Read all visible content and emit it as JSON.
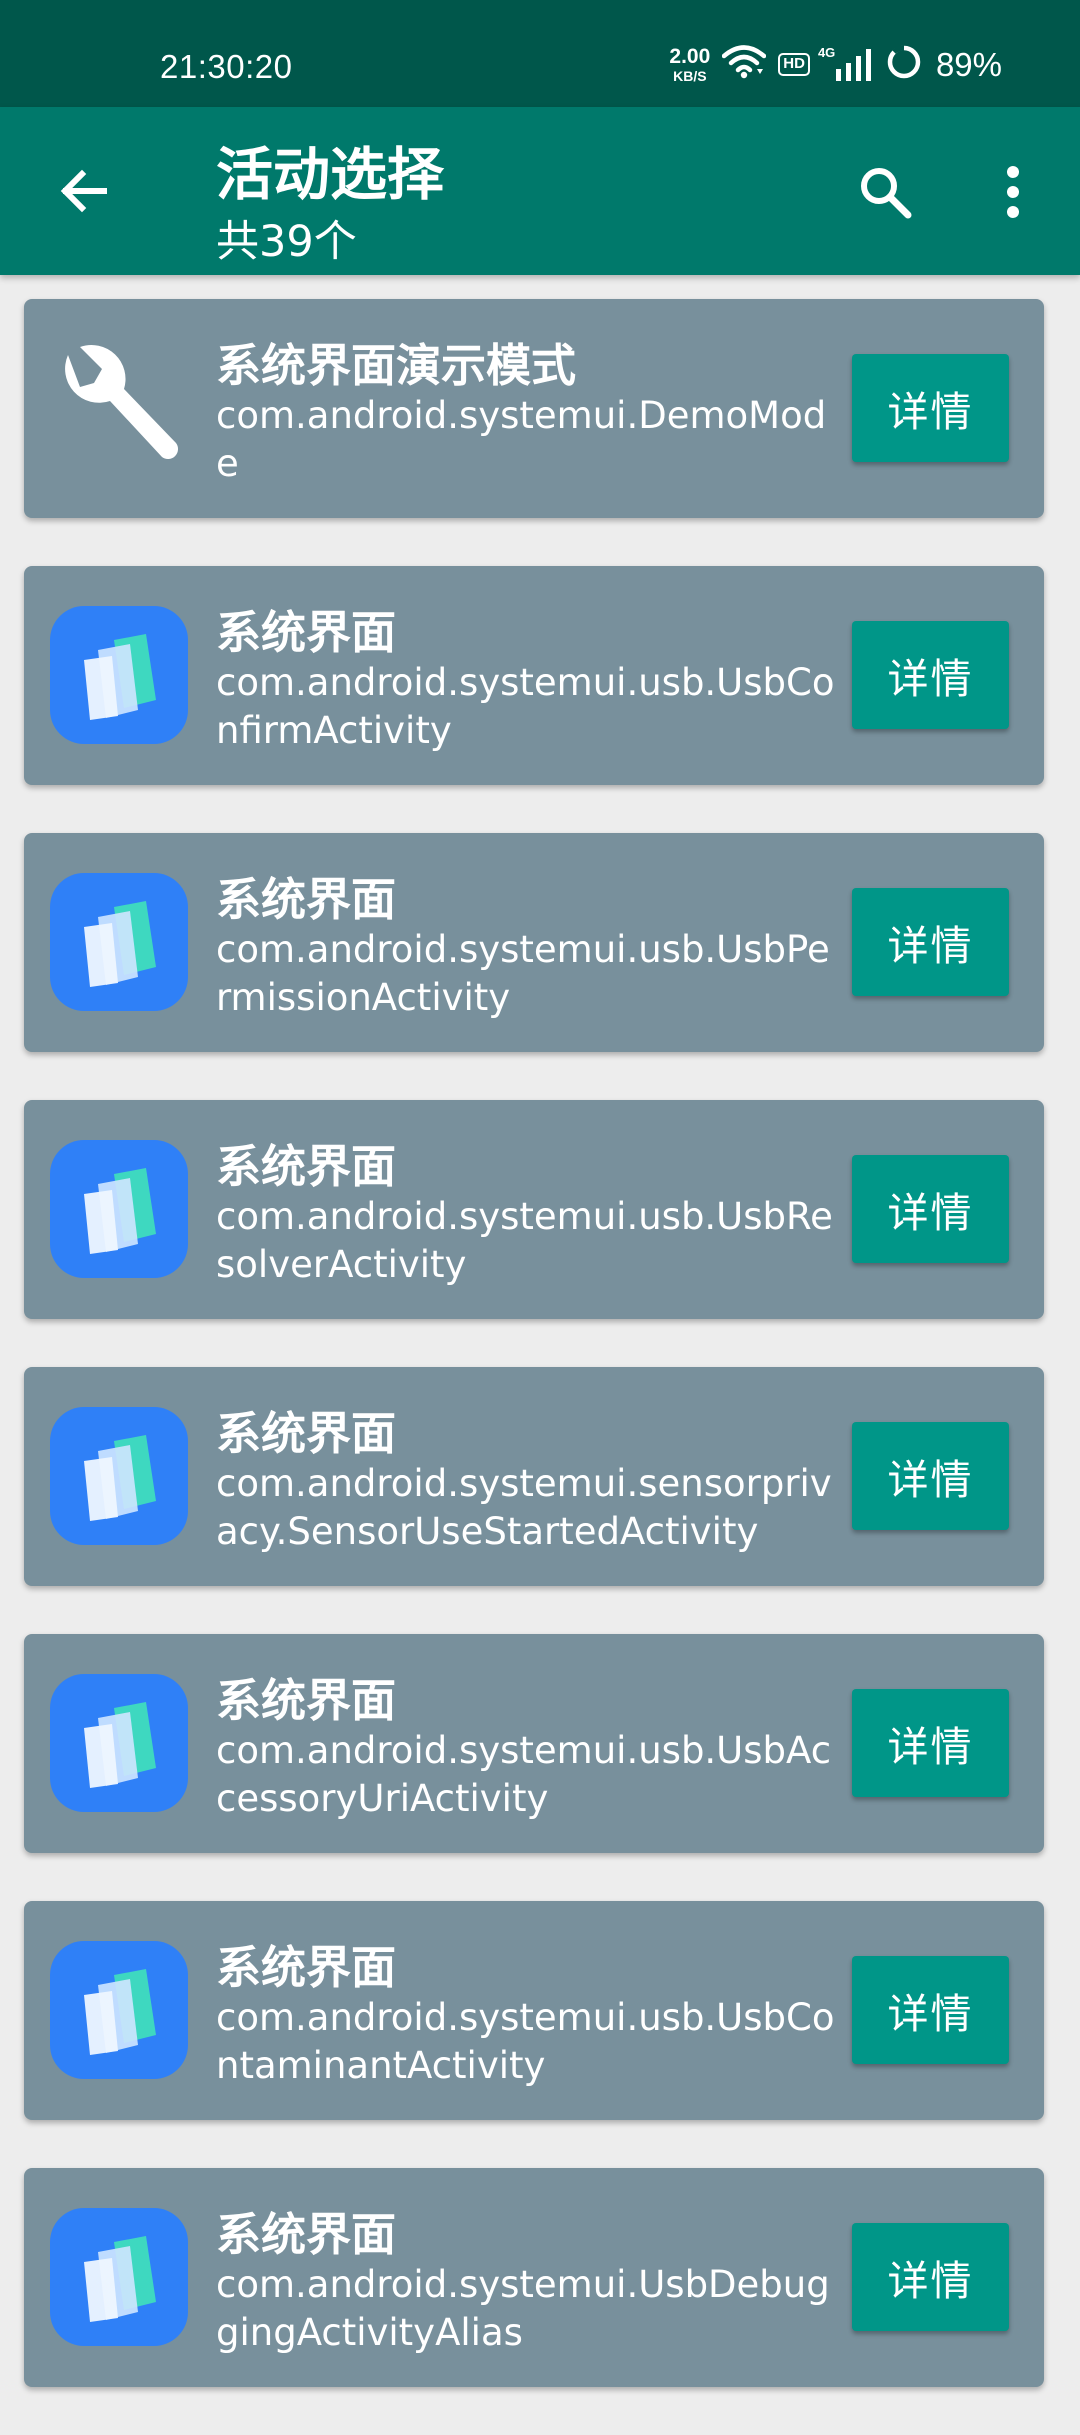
{
  "status_bar": {
    "time": "21:30:20",
    "net_speed_value": "2.00",
    "net_speed_unit": "KB/S",
    "hd_label": "HD",
    "network_type": "4G",
    "battery": "89%",
    "icons": [
      "wifi-icon",
      "hd-icon",
      "signal-icon",
      "battery-icon"
    ]
  },
  "app_bar": {
    "title": "活动选择",
    "subtitle": "共39个",
    "icons": [
      "back-arrow-icon",
      "search-icon",
      "more-vert-icon"
    ],
    "color": "#00796b"
  },
  "activities": [
    {
      "title": "系统界面演示模式",
      "name": "com.android.systemui.DemoMode",
      "icon": "wrench-icon",
      "button": "详情"
    },
    {
      "title": "系统界面",
      "name": "com.android.systemui.usb.UsbConfirmActivity",
      "icon": "systemui-app-icon",
      "button": "详情"
    },
    {
      "title": "系统界面",
      "name": "com.android.systemui.usb.UsbPermissionActivity",
      "icon": "systemui-app-icon",
      "button": "详情"
    },
    {
      "title": "系统界面",
      "name": "com.android.systemui.usb.UsbResolverActivity",
      "icon": "systemui-app-icon",
      "button": "详情"
    },
    {
      "title": "系统界面",
      "name": "com.android.systemui.sensorprivacy.SensorUseStartedActivity",
      "icon": "systemui-app-icon",
      "button": "详情"
    },
    {
      "title": "系统界面",
      "name": "com.android.systemui.usb.UsbAccessoryUriActivity",
      "icon": "systemui-app-icon",
      "button": "详情"
    },
    {
      "title": "系统界面",
      "name": "com.android.systemui.usb.UsbContaminantActivity",
      "icon": "systemui-app-icon",
      "button": "详情"
    },
    {
      "title": "系统界面",
      "name": "com.android.systemui.UsbDebuggingActivityAlias",
      "icon": "systemui-app-icon",
      "button": "详情"
    }
  ],
  "colors": {
    "status_bar": "#00574b",
    "card": "#78909c",
    "button": "#009688",
    "background": "#ededed"
  }
}
